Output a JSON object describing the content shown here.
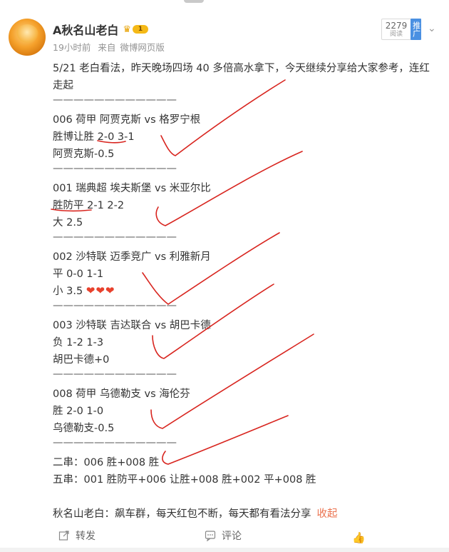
{
  "author": {
    "name": "A秋名山老白",
    "vip_level": "1"
  },
  "meta": {
    "time": "19小时前",
    "source_prefix": "来自",
    "source": "微博网页版"
  },
  "stats": {
    "read_count": "2279",
    "read_label": "阅读",
    "promote_label": "推广"
  },
  "post": {
    "intro_line1": "5/21 老白看法，昨天晚场四场 40 多倍高水拿下，今天继续分享给大家参考，连红",
    "intro_line2": "走起",
    "divider": "————————————",
    "matches": [
      {
        "title": "006 荷甲 阿贾克斯 vs 格罗宁根",
        "pick1": "胜博让胜 2-0 3-1",
        "pick2": "阿贾克斯-0.5"
      },
      {
        "title": "001 瑞典超 埃夫斯堡 vs 米亚尔比",
        "pick1": "胜防平 2-1 2-2",
        "pick2": "大 2.5"
      },
      {
        "title": "002 沙特联 迈季竞广 vs 利雅新月",
        "pick1": "平 0-0 1-1",
        "pick2": "小 3.5"
      },
      {
        "title": "003 沙特联 吉达联合 vs 胡巴卡德",
        "pick1": "负 1-2 1-3",
        "pick2": "胡巴卡德+0"
      },
      {
        "title": "008 荷甲 乌德勒支 vs 海伦芬",
        "pick1": "胜 2-0 1-0",
        "pick2": "乌德勒支-0.5"
      }
    ],
    "parlay2": "二串：006 胜+008 胜",
    "parlay5": "五串：001 胜防平+006 让胜+008 胜+002 平+008 胜",
    "footer": "秋名山老白：飙车群，每天红包不断，每天都有看法分享",
    "collapse": "收起"
  },
  "actions": {
    "forward": "转发",
    "comment": "评论"
  },
  "colors": {
    "annotation_red": "#d8251f",
    "link": "#eb7350",
    "heart": "#e8412c"
  }
}
